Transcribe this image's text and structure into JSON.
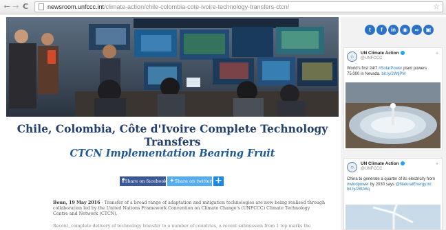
{
  "browser": {
    "url_host": "newsroom.unfccc.int",
    "url_path": "/climate-action/chile-colombia-cote-ivoire-technology-transfers-ctcn/"
  },
  "article": {
    "title": "Chile, Colombia, Côte d'Ivoire Complete Technology Transfers",
    "subtitle": "CTCN Implementation Bearing Fruit",
    "share_facebook": "Share on facebook",
    "share_twitter": "Share on twitter",
    "share_more": "+",
    "para1_dateline": "Bonn, 19 May 2016",
    "para1_text": " - Transfer of a broad range of adaptation and mitigation technologies are now being realised through collaboration led by the United Nations Framework Convention on Climate Change's (UNFCCC) Climate Technology Centre and Network (CTCN).",
    "para2_text": "Recent, complete delivery of technology transfer to a number of countries, a recent submission from 1 top marks the"
  },
  "sidebar": {
    "social": [
      "t",
      "f",
      "in",
      "◉",
      "∞",
      "▣"
    ],
    "tweets": [
      {
        "account": "UN Climate Action",
        "handle": "@UNFCCC",
        "text_before": "World's first 24/7 ",
        "hashtag": "#SolarPower",
        "text_after": " plant powers 75,000 in Nevada. ",
        "link": "bit.ly/2WtjPM"
      },
      {
        "account": "UN Climate Action",
        "handle": "@UNFCCC",
        "line1": "China to generate a quarter of its electricity from",
        "hashtag": "#windpower",
        "mid": " by 2030 says ",
        "mention": "@NaturalEnergy.int",
        "link": "bit.ly/28tA6q"
      }
    ]
  },
  "colors": {
    "title": "#233f6e",
    "subtitle": "#1f5a96",
    "facebook": "#3b5998",
    "twitter": "#55acee",
    "social_blue": "#2c72c7"
  }
}
